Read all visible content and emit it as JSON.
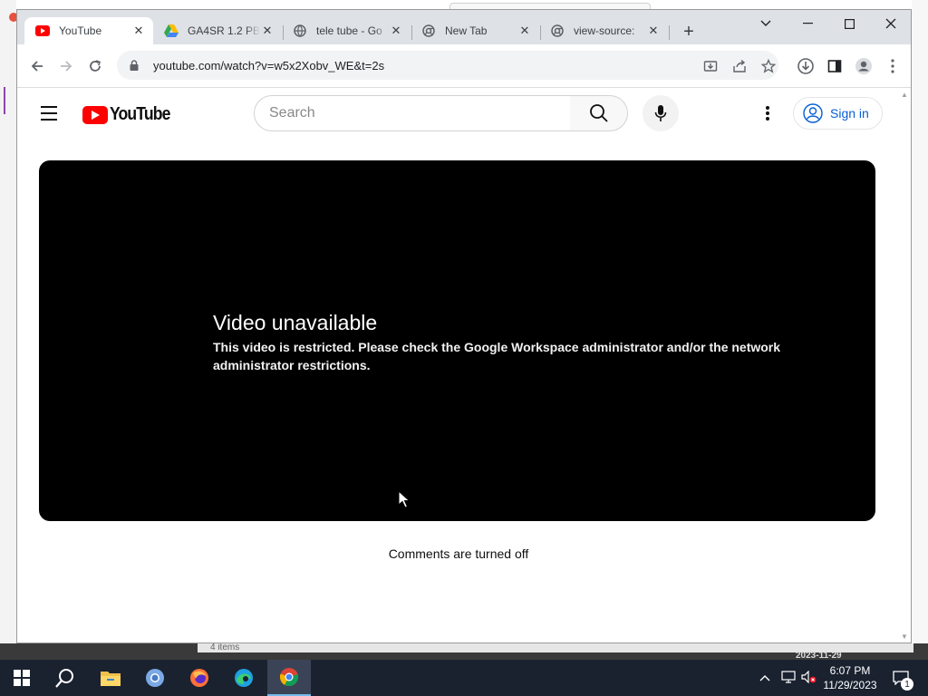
{
  "browser": {
    "tabs": [
      {
        "title": "YouTube",
        "favicon": "youtube-favicon",
        "active": true
      },
      {
        "title": "GA4SR 1.2 PB",
        "favicon": "google-drive-favicon",
        "active": false
      },
      {
        "title": "tele tube - Go",
        "favicon": "globe-favicon",
        "active": false
      },
      {
        "title": "New Tab",
        "favicon": "chrome-favicon",
        "active": false
      },
      {
        "title": "view-source:",
        "favicon": "chrome-favicon",
        "active": false
      }
    ],
    "url": "youtube.com/watch?v=w5x2Xobv_WE&t=2s"
  },
  "youtube": {
    "logo_text": "YouTube",
    "search_placeholder": "Search",
    "sign_in_label": "Sign in",
    "player": {
      "heading": "Video unavailable",
      "message": "This video is restricted. Please check the Google Workspace administrator and/or the network administrator restrictions."
    },
    "comments_status": "Comments are turned off"
  },
  "background": {
    "items_text": "4 items",
    "date_text": "2023-11-29"
  },
  "taskbar": {
    "items": [
      "start-icon",
      "search-icon",
      "file-explorer-icon",
      "chromium-icon",
      "firefox-icon",
      "edge-icon",
      "chrome-icon"
    ],
    "time": "6:07 PM",
    "date": "11/29/2023",
    "notification_count": "1"
  },
  "colors": {
    "youtube_red": "#ff0000",
    "link_blue": "#065fd4",
    "taskbar": "#1a2230"
  }
}
